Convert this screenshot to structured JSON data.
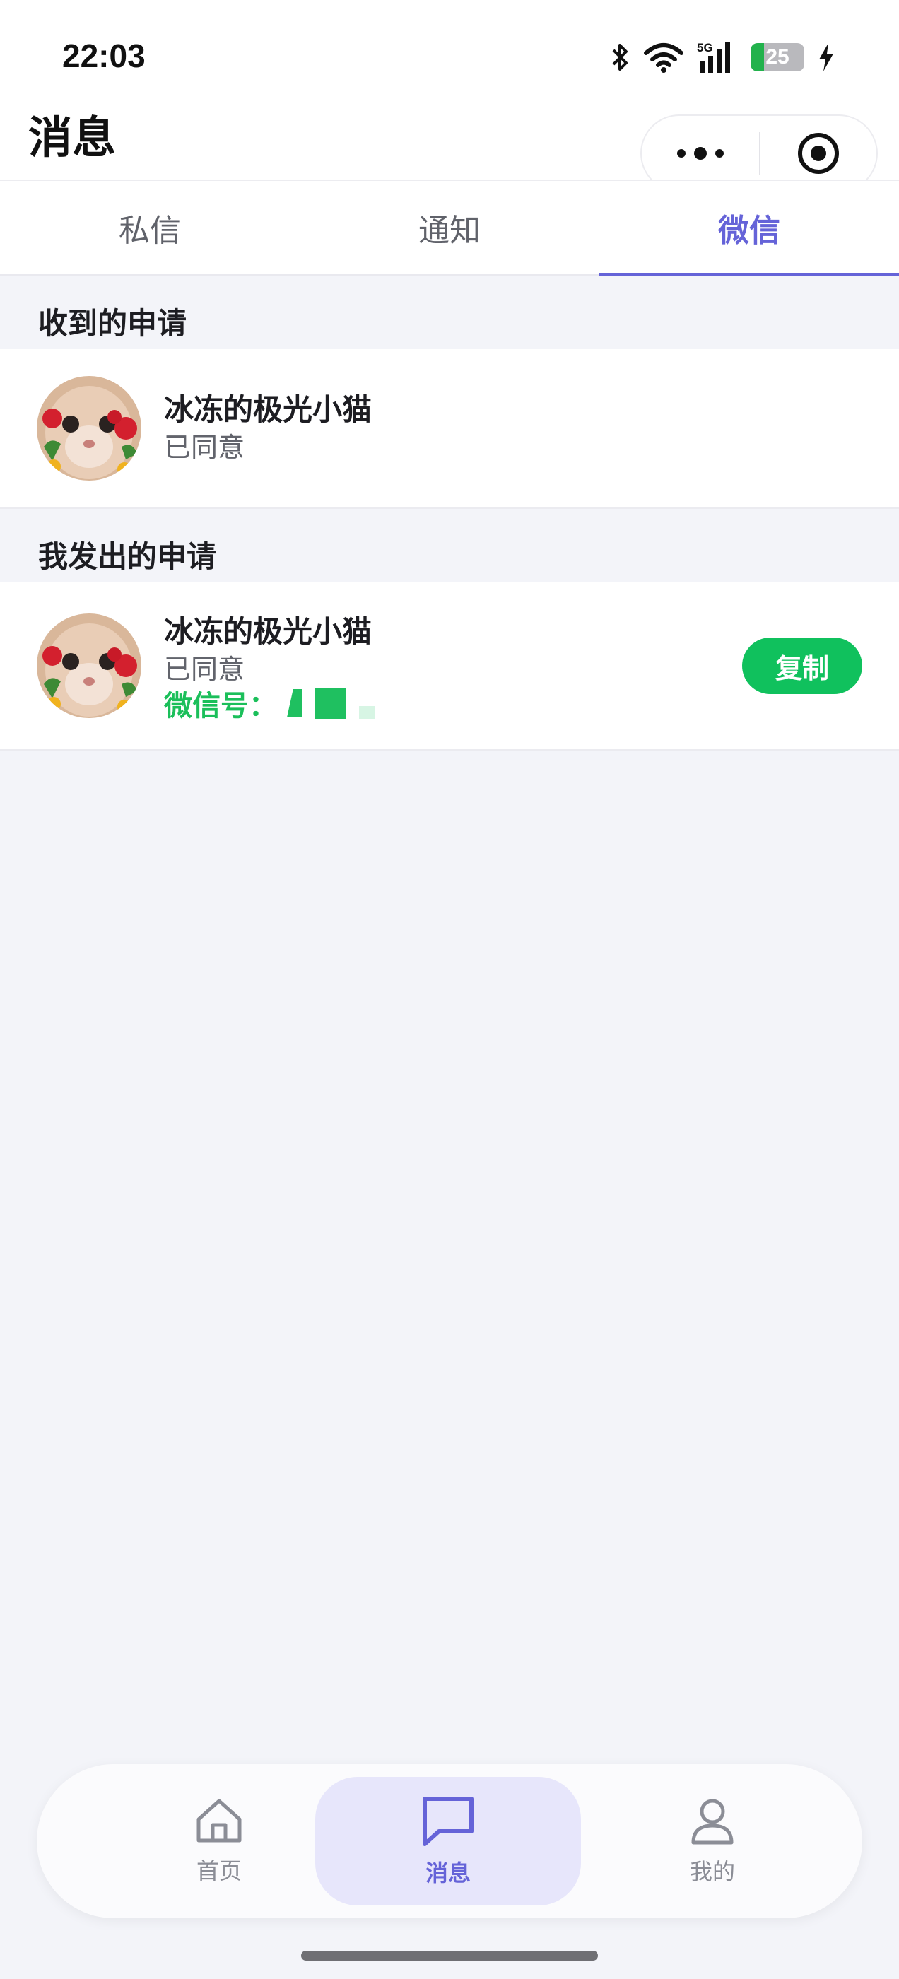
{
  "status_bar": {
    "time": "22:03",
    "network": "5G",
    "battery": "25",
    "battery_level": 0.25,
    "icons": [
      "bluetooth-icon",
      "wifi-icon",
      "signal-icon",
      "battery-icon",
      "charging-icon"
    ]
  },
  "header": {
    "title": "消息",
    "capsule_icons": [
      "more-icon",
      "target-icon"
    ]
  },
  "tabs": [
    {
      "label": "私信",
      "active": false
    },
    {
      "label": "通知",
      "active": false
    },
    {
      "label": "微信",
      "active": true
    }
  ],
  "received": {
    "section_title": "收到的申请",
    "items": [
      {
        "name": "冰冻的极光小猫",
        "status": "已同意"
      }
    ]
  },
  "sent": {
    "section_title": "我发出的申请",
    "items": [
      {
        "name": "冰冻的极光小猫",
        "status": "已同意",
        "wechat_label": "微信号：",
        "copy_label": "复制"
      }
    ]
  },
  "bottom_nav": {
    "items": [
      {
        "label": "首页",
        "icon": "home-icon",
        "active": false
      },
      {
        "label": "消息",
        "icon": "chat-icon",
        "active": true
      },
      {
        "label": "我的",
        "icon": "user-icon",
        "active": false
      }
    ]
  },
  "colors": {
    "accent": "#6563d8",
    "green": "#10c15d",
    "background": "#f3f4f9"
  }
}
